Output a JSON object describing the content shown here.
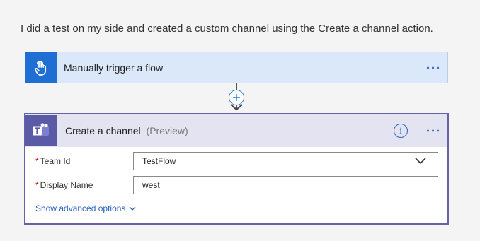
{
  "intro_text": "I did a test on my side and created a custom channel using the Create a channel action.",
  "trigger": {
    "title": "Manually trigger a flow",
    "icon": "hand-touch-icon",
    "color": "#1f6ed4"
  },
  "action": {
    "title": "Create a channel",
    "preview_label": "(Preview)",
    "icon": "teams-icon",
    "color": "#6264a7",
    "info_symbol": "i",
    "fields": [
      {
        "required_mark": "*",
        "label": "Team Id",
        "value": "TestFlow"
      },
      {
        "required_mark": "*",
        "label": "Display Name",
        "value": "west"
      }
    ],
    "advanced_label": "Show advanced options"
  }
}
